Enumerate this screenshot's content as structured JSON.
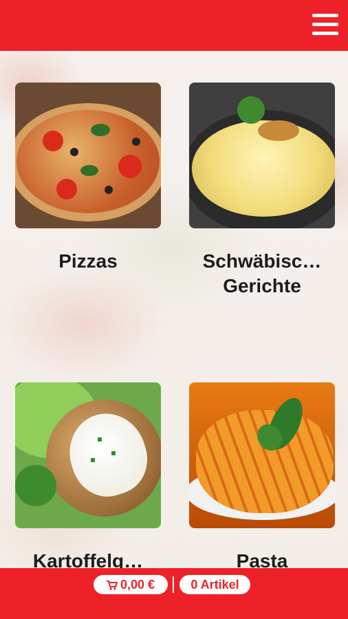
{
  "header": {
    "menu_icon": "hamburger-menu-icon",
    "color": "#ee2128"
  },
  "categories": [
    {
      "label": "Pizzas",
      "image": "pizza"
    },
    {
      "label": "Schwäbisc…\nGerichte",
      "label_line1": "Schwäbisc…",
      "label_line2": "Gerichte",
      "image": "spaetzle"
    },
    {
      "label": "Kartoffelg…",
      "image": "baked-potato"
    },
    {
      "label": "Pasta",
      "image": "penne-pasta"
    }
  ],
  "footer": {
    "price": "0,00 €",
    "items": "0 Artikel",
    "cart_icon": "cart-icon"
  }
}
